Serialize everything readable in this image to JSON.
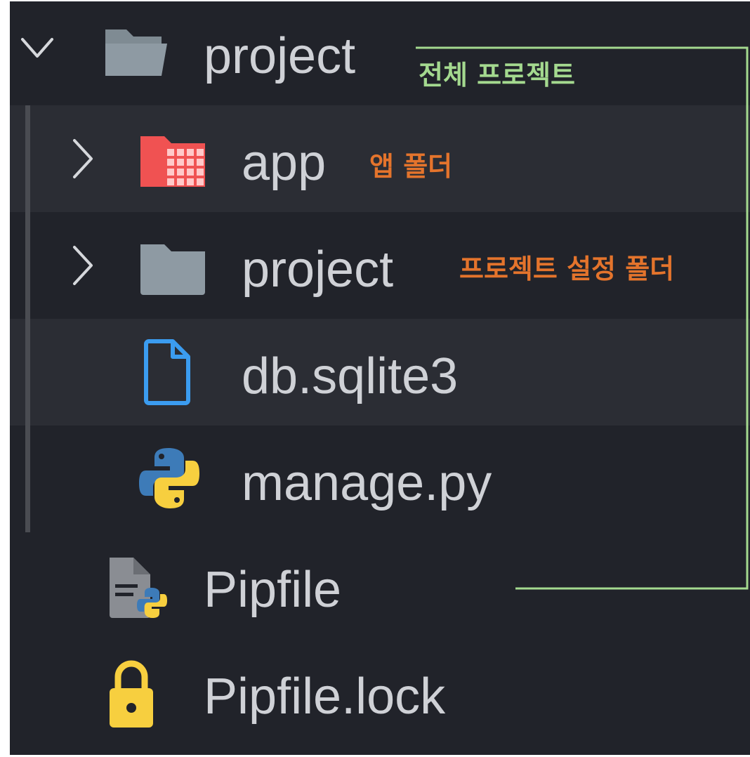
{
  "explorer": {
    "items": [
      {
        "label": "project",
        "icon": "folder-open-icon",
        "expanded": true
      },
      {
        "label": "app",
        "icon": "app-folder-icon",
        "expanded": false
      },
      {
        "label": "project",
        "icon": "folder-icon",
        "expanded": false
      },
      {
        "label": "db.sqlite3",
        "icon": "file-icon"
      },
      {
        "label": "manage.py",
        "icon": "python-icon"
      },
      {
        "label": "Pipfile",
        "icon": "pipfile-icon"
      },
      {
        "label": "Pipfile.lock",
        "icon": "lock-icon"
      }
    ]
  },
  "annotations": {
    "whole_project": "전체 프로젝트",
    "app_folder": "앱 폴더",
    "project_settings_folder": "프로젝트 설정 폴더"
  },
  "colors": {
    "background": "#21232a",
    "row_highlight": "#2b2d34",
    "text": "#cfd1d6",
    "annotation_green": "#a4d98f",
    "annotation_orange": "#e4742c",
    "file_icon": "#3b9cf0",
    "app_folder": "#f05252",
    "folder": "#8e9aa3",
    "lock_icon": "#f7cf3f"
  }
}
